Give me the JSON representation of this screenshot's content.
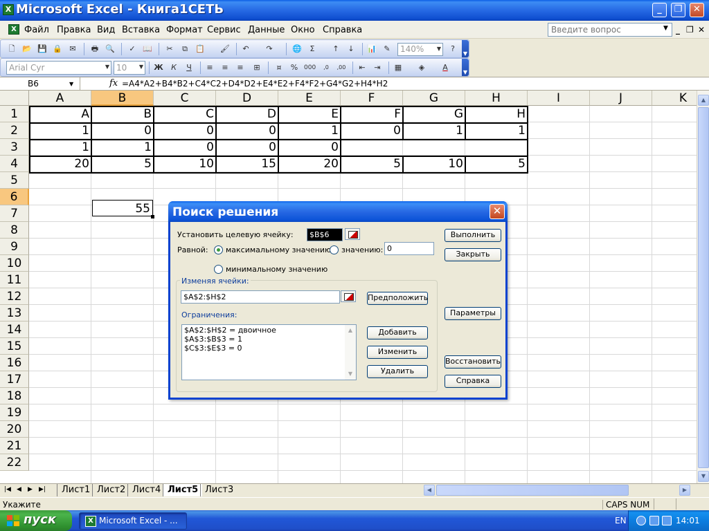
{
  "window": {
    "title": "Microsoft Excel - Книга1СЕТЬ",
    "app_icon": "X"
  },
  "menu": {
    "items": [
      "Файл",
      "Правка",
      "Вид",
      "Вставка",
      "Формат",
      "Сервис",
      "Данные",
      "Окно",
      "Справка"
    ],
    "help_placeholder": "Введите вопрос"
  },
  "toolbar": {
    "zoom": "140%",
    "font_name": "Arial Cyr",
    "font_size": "10"
  },
  "formula_bar": {
    "name_box": "B6",
    "fx": "fx",
    "formula": "=A4*A2+B4*B2+C4*C2+D4*D2+E4*E2+F4*F2+G4*G2+H4*H2"
  },
  "sheet": {
    "columns": [
      "A",
      "B",
      "C",
      "D",
      "E",
      "F",
      "G",
      "H",
      "I",
      "J",
      "K"
    ],
    "rows": [
      "1",
      "2",
      "3",
      "4",
      "5",
      "6",
      "7",
      "8",
      "9",
      "10",
      "11",
      "12",
      "13",
      "14",
      "15",
      "16",
      "17",
      "18",
      "19",
      "20",
      "21",
      "22"
    ],
    "selected_column": "B",
    "selected_row": "6",
    "cells": {
      "row1": [
        "A",
        "B",
        "C",
        "D",
        "E",
        "F",
        "G",
        "H"
      ],
      "row2": [
        "1",
        "0",
        "0",
        "0",
        "1",
        "0",
        "1",
        "1"
      ],
      "row3": [
        "1",
        "1",
        "0",
        "0",
        "0"
      ],
      "row4": [
        "20",
        "5",
        "10",
        "15",
        "20",
        "5",
        "10",
        "5"
      ],
      "B6": "55"
    }
  },
  "sheet_tabs": {
    "tabs": [
      "Лист1",
      "Лист2",
      "Лист4",
      "Лист5",
      "Лист3"
    ],
    "active": "Лист5"
  },
  "status": {
    "text": "Укажите",
    "caps": "CAPS NUM"
  },
  "solver": {
    "title": "Поиск решения",
    "close": "✕",
    "target_label": "Установить целевую ячейку:",
    "target_value": "$B$6",
    "equal_label": "Равной:",
    "radio_max": "максимальному значению",
    "radio_value": "значению:",
    "value_input": "0",
    "radio_min": "минимальному значению",
    "changing_label": "Изменяя ячейки:",
    "changing_value": "$A$2:$H$2",
    "guess_button": "Предположить",
    "constraints_label": "Ограничения:",
    "constraints": [
      "$A$2:$H$2 = двоичное",
      "$A$3:$B$3 = 1",
      "$C$3:$E$3 = 0"
    ],
    "add_button": "Добавить",
    "change_button": "Изменить",
    "delete_button": "Удалить",
    "solve_button": "Выполнить",
    "close_button": "Закрыть",
    "options_button": "Параметры",
    "reset_button": "Восстановить",
    "help_button": "Справка"
  },
  "taskbar": {
    "start": "пуск",
    "task": "Microsoft Excel - ...",
    "lang": "EN",
    "time": "14:01"
  }
}
